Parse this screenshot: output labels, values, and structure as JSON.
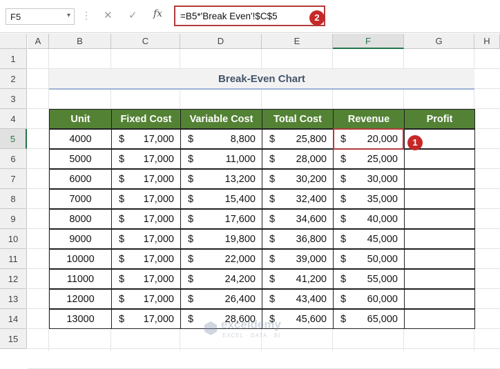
{
  "formula_bar": {
    "name_box": "F5",
    "name_box_arrow": "▾",
    "more": "⋮",
    "cancel": "✕",
    "enter": "✓",
    "fx": "fx",
    "formula": "=B5*'Break Even'!$C$5"
  },
  "markers": {
    "one": "1",
    "two": "2"
  },
  "columns": [
    "A",
    "B",
    "C",
    "D",
    "E",
    "F",
    "G",
    "H"
  ],
  "selected_column": "F",
  "rows": [
    "1",
    "2",
    "3",
    "4",
    "5",
    "6",
    "7",
    "8",
    "9",
    "10",
    "11",
    "12",
    "13",
    "14",
    "15"
  ],
  "selected_row": "5",
  "title": "Break-Even Chart",
  "table": {
    "headers": [
      "Unit",
      "Fixed Cost",
      "Variable Cost",
      "Total Cost",
      "Revenue",
      "Profit"
    ],
    "currency": "$",
    "rows": [
      {
        "unit": "4000",
        "fixed": "17,000",
        "variable": "8,800",
        "total": "25,800",
        "revenue": "20,000"
      },
      {
        "unit": "5000",
        "fixed": "17,000",
        "variable": "11,000",
        "total": "28,000",
        "revenue": "25,000"
      },
      {
        "unit": "6000",
        "fixed": "17,000",
        "variable": "13,200",
        "total": "30,200",
        "revenue": "30,000"
      },
      {
        "unit": "7000",
        "fixed": "17,000",
        "variable": "15,400",
        "total": "32,400",
        "revenue": "35,000"
      },
      {
        "unit": "8000",
        "fixed": "17,000",
        "variable": "17,600",
        "total": "34,600",
        "revenue": "40,000"
      },
      {
        "unit": "9000",
        "fixed": "17,000",
        "variable": "19,800",
        "total": "36,800",
        "revenue": "45,000"
      },
      {
        "unit": "10000",
        "fixed": "17,000",
        "variable": "22,000",
        "total": "39,000",
        "revenue": "50,000"
      },
      {
        "unit": "11000",
        "fixed": "17,000",
        "variable": "24,200",
        "total": "41,200",
        "revenue": "55,000"
      },
      {
        "unit": "12000",
        "fixed": "17,000",
        "variable": "26,400",
        "total": "43,400",
        "revenue": "60,000"
      },
      {
        "unit": "13000",
        "fixed": "17,000",
        "variable": "28,600",
        "total": "45,600",
        "revenue": "65,000"
      }
    ]
  },
  "watermark": {
    "name": "exceldemy",
    "tagline": "EXCEL · DATA · BI"
  },
  "colors": {
    "header_green": "#548235",
    "highlight_red": "#b23a3a",
    "marker_red": "#c62828",
    "title_text": "#44546a"
  }
}
